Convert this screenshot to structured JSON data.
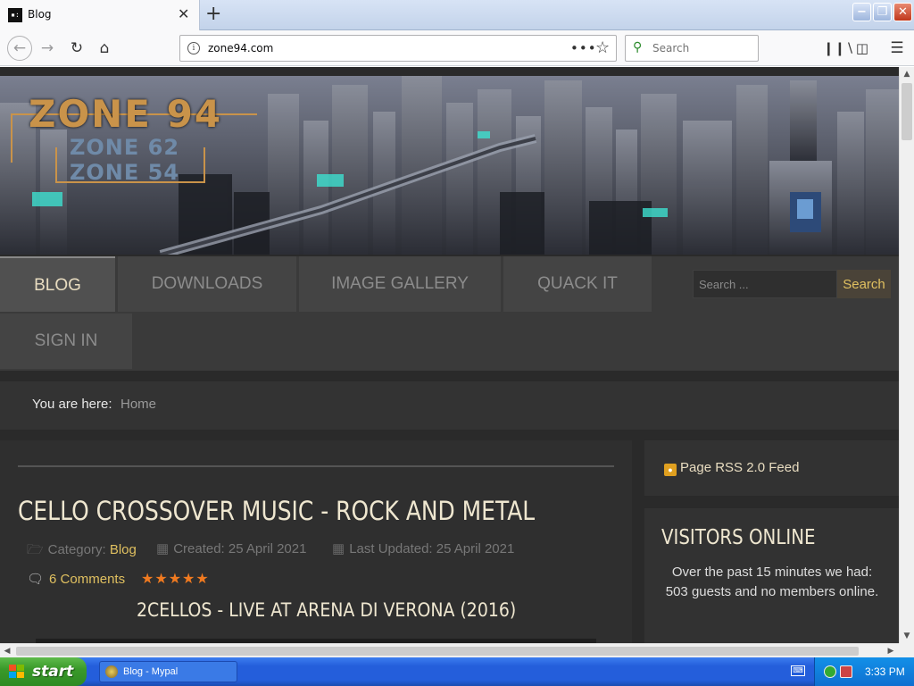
{
  "browser": {
    "tab_title": "Blog",
    "tab_favicon": "▪:",
    "tab_close": "✕",
    "new_tab": "+",
    "url": "zone94.com",
    "page_actions": "•••",
    "search_placeholder": "Search",
    "window_controls": {
      "minimize": "−",
      "maximize": "❐",
      "close": "✕"
    }
  },
  "site": {
    "logo": {
      "main": "ZONE 94",
      "sub1": "ZONE 62",
      "sub2": "ZONE 54"
    },
    "nav": {
      "items": [
        {
          "label": "BLOG",
          "active": true
        },
        {
          "label": "DOWNLOADS",
          "active": false
        },
        {
          "label": "IMAGE GALLERY",
          "active": false
        },
        {
          "label": "QUACK IT",
          "active": false
        },
        {
          "label": "SIGN IN",
          "active": false
        }
      ],
      "search_placeholder": "Search ...",
      "search_button": "Search"
    },
    "breadcrumb": {
      "prefix": "You are here:",
      "current": "Home"
    },
    "article": {
      "title": "CELLO CROSSOVER MUSIC - ROCK AND METAL",
      "category_label": "Category:",
      "category_value": "Blog",
      "created": "Created: 25 April 2021",
      "updated": "Last Updated: 25 April 2021",
      "comments": "6 Comments",
      "rating_stars": 5,
      "video_title": "2CELLOS - LIVE AT ARENA DI VERONA (2016)"
    },
    "sidebar": {
      "rss_label": "Page RSS 2.0 Feed",
      "visitors_title": "VISITORS ONLINE",
      "visitors_text": "Over the past 15 minutes we had: 503 guests and no members online."
    }
  },
  "taskbar": {
    "start_label": "start",
    "task_label": "Blog - Mypal",
    "clock": "3:33 PM"
  },
  "colors": {
    "accent_gold": "#e0c060",
    "star_orange": "#f07a20",
    "logo_gold": "#c9934a",
    "logo_blue": "#6f8aa8"
  }
}
